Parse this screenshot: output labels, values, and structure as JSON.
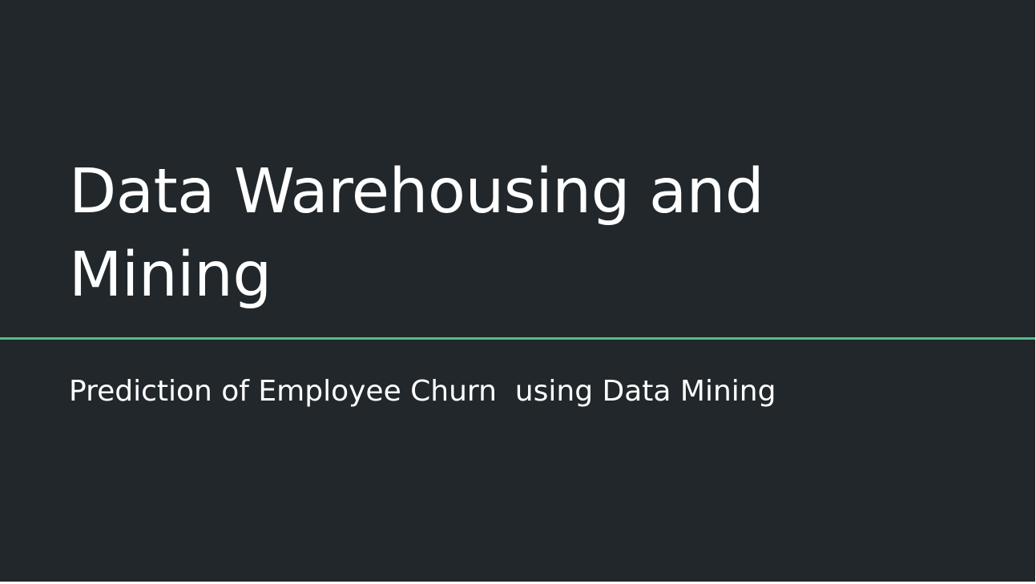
{
  "slide": {
    "title_line1": "Data Warehousing and",
    "title_line2": "Mining",
    "subtitle": "Prediction of Employee Churn  using Data Mining"
  },
  "colors": {
    "background": "#21272a",
    "text": "#ffffff",
    "accent_rule": "#4fbf8a"
  }
}
